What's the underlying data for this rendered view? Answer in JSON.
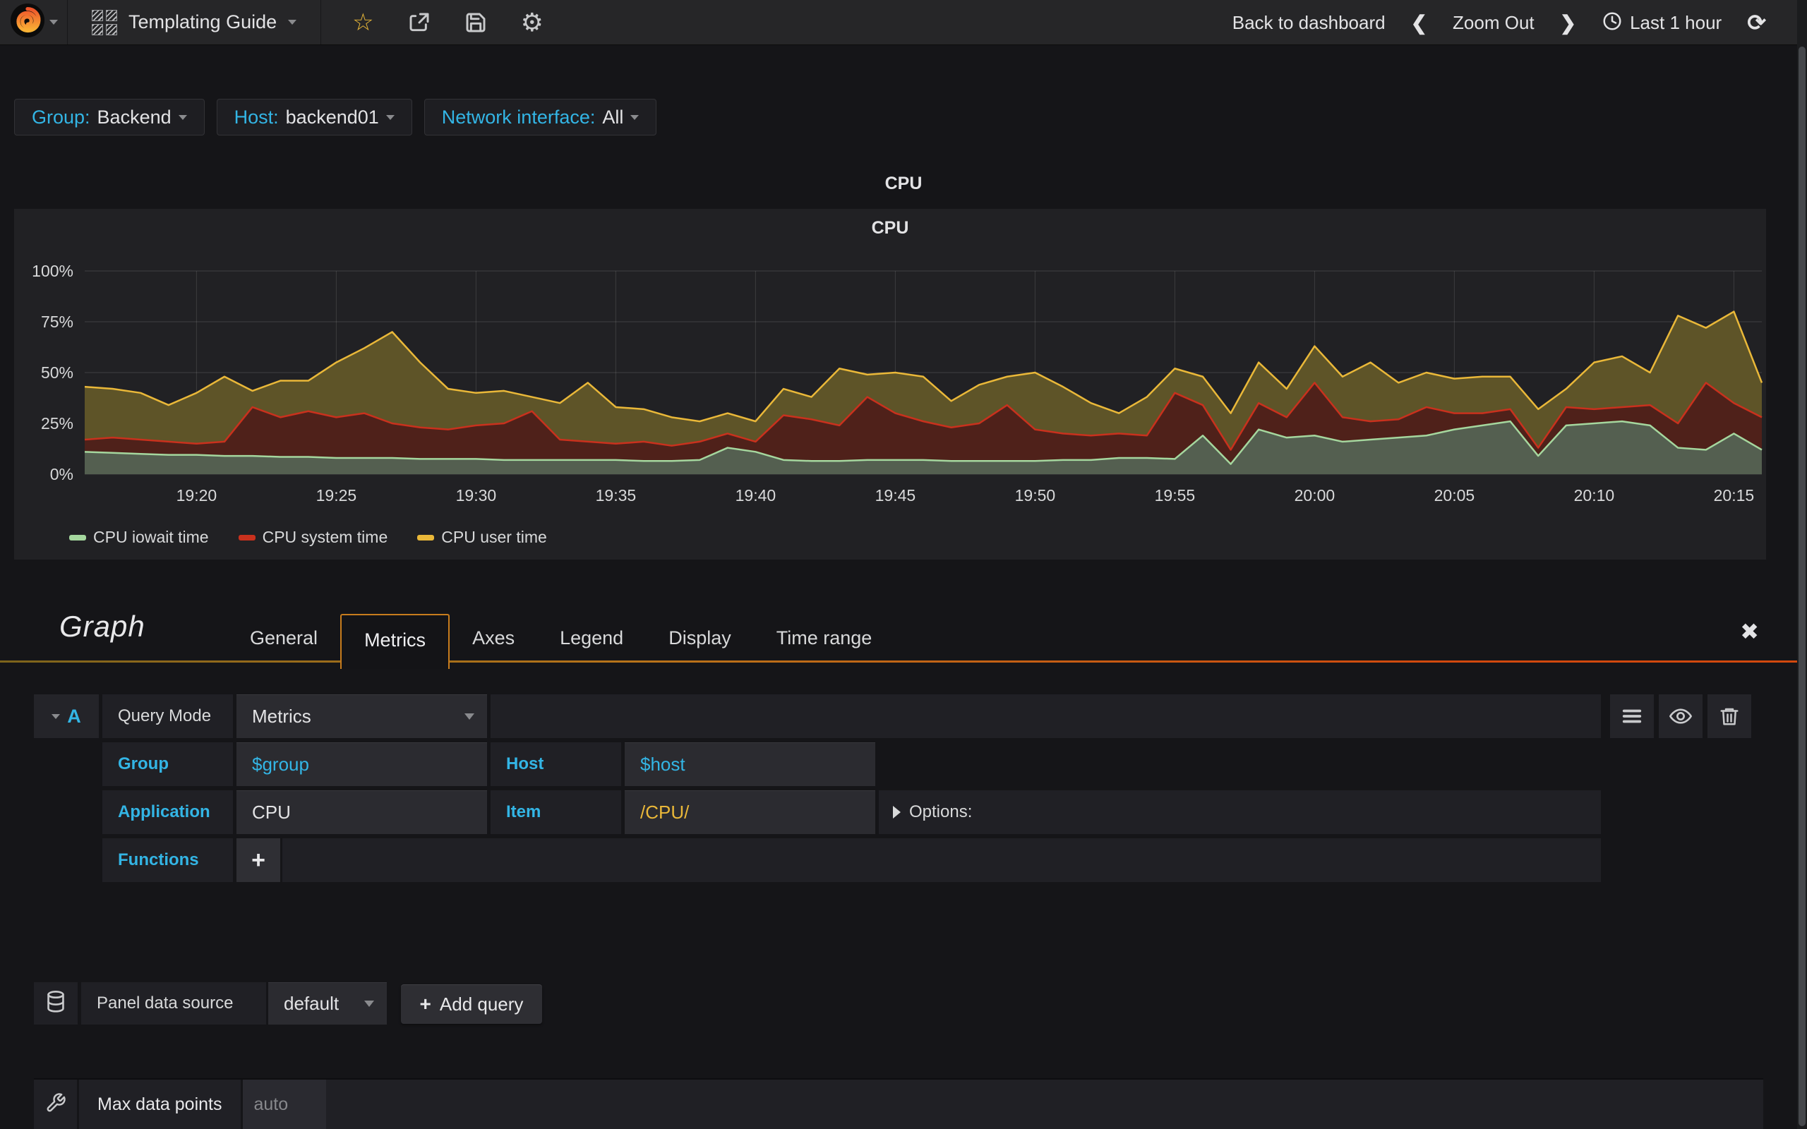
{
  "colors": {
    "accent_blue": "#33b5e5",
    "accent_yellow": "#eab839",
    "tab_border_orange": "#c77c1d",
    "navbar_bg": "#262628",
    "panel_bg": "#212124"
  },
  "navbar": {
    "dashboard_title": "Templating Guide",
    "back_to_dashboard": "Back to dashboard",
    "zoom_out": "Zoom Out",
    "time_range": "Last 1 hour",
    "chevron_left": "❮",
    "chevron_right": "❯",
    "star_glyph": "☆",
    "refresh_glyph": "⟳"
  },
  "variables": [
    {
      "label": "Group:",
      "value": "Backend"
    },
    {
      "label": "Host:",
      "value": "backend01"
    },
    {
      "label": "Network interface:",
      "value": "All"
    }
  ],
  "row_title": "CPU",
  "panel": {
    "title": "CPU"
  },
  "chart_data": {
    "type": "area",
    "stacked": true,
    "title": "CPU",
    "unit": "%",
    "ylim": [
      0,
      100
    ],
    "y_tick_values": [
      0,
      25,
      50,
      75,
      100
    ],
    "y_tick_labels": [
      "0%",
      "25%",
      "50%",
      "75%",
      "100%"
    ],
    "x_start": "19:16",
    "x_end": "20:16",
    "x_step_minutes": 1,
    "x_tick_indices": [
      4,
      9,
      14,
      19,
      24,
      29,
      34,
      39,
      44,
      49,
      54,
      59
    ],
    "x_tick_labels": [
      "19:20",
      "19:25",
      "19:30",
      "19:35",
      "19:40",
      "19:45",
      "19:50",
      "19:55",
      "20:00",
      "20:05",
      "20:10",
      "20:15"
    ],
    "grid": true,
    "legend_position": "bottom",
    "series": [
      {
        "name": "CPU iowait time",
        "color": "#a5d79e",
        "fill": "#545f50",
        "values": [
          11,
          10.5,
          10,
          9.5,
          9.5,
          9,
          9,
          8.5,
          8.5,
          8,
          8,
          8,
          7.5,
          7.5,
          7.5,
          7,
          7,
          7,
          7,
          7,
          6.5,
          6.5,
          7,
          13,
          11,
          7,
          6.5,
          6.5,
          7,
          7,
          7,
          6.5,
          6.5,
          6.5,
          6.5,
          7,
          7,
          8,
          8,
          7.5,
          19,
          5,
          22,
          18,
          19,
          16,
          17,
          18,
          19,
          22,
          24,
          26,
          9,
          24,
          25,
          26,
          24,
          13,
          12,
          20,
          12
        ]
      },
      {
        "name": "CPU system time",
        "color": "#c9311d",
        "fill": "#4f211a",
        "values": [
          6,
          7.5,
          7,
          6.5,
          5.5,
          7,
          24,
          19.5,
          22.5,
          20,
          22,
          17,
          15.5,
          14.5,
          16.5,
          18,
          24,
          10,
          9,
          8,
          9.5,
          7.5,
          9,
          7,
          5,
          22,
          20.5,
          17.5,
          31,
          23,
          19,
          16.5,
          18.5,
          27.5,
          15.5,
          13,
          12,
          12,
          11,
          32.5,
          15,
          7,
          13,
          10,
          26,
          12,
          9,
          9,
          14,
          8,
          6,
          6,
          4,
          9,
          7,
          7,
          10,
          12,
          33,
          15,
          16
        ]
      },
      {
        "name": "CPU user time",
        "color": "#eab839",
        "fill": "#5e5428",
        "values": [
          26,
          24,
          23,
          18,
          25,
          32,
          8,
          18,
          15,
          27,
          32,
          45,
          32,
          20,
          16,
          16,
          7,
          18,
          29,
          18,
          16,
          14,
          10,
          10,
          10,
          13,
          11,
          28,
          11,
          20,
          22,
          13,
          19,
          14,
          28,
          23,
          16,
          10,
          19,
          12,
          14,
          18,
          20,
          14,
          18,
          20,
          29,
          18,
          17,
          17,
          18,
          16,
          19,
          9,
          23,
          25,
          16,
          53,
          27,
          45,
          17
        ]
      }
    ]
  },
  "editor": {
    "panel_type": "Graph",
    "tabs": [
      "General",
      "Metrics",
      "Axes",
      "Legend",
      "Display",
      "Time range"
    ],
    "active_tab": "Metrics",
    "close_glyph": "✖",
    "query": {
      "letter": "A",
      "query_mode_label": "Query Mode",
      "query_mode_value": "Metrics",
      "group_label": "Group",
      "group_value": "$group",
      "host_label": "Host",
      "host_value": "$host",
      "application_label": "Application",
      "application_value": "CPU",
      "item_label": "Item",
      "item_value": "/CPU/",
      "options_label": "Options:",
      "functions_label": "Functions",
      "add_function_glyph": "+"
    },
    "datasource": {
      "label": "Panel data source",
      "value": "default",
      "add_query_plus": "+",
      "add_query_label": "Add query"
    },
    "max_data_points": {
      "label": "Max data points",
      "placeholder": "auto"
    }
  }
}
